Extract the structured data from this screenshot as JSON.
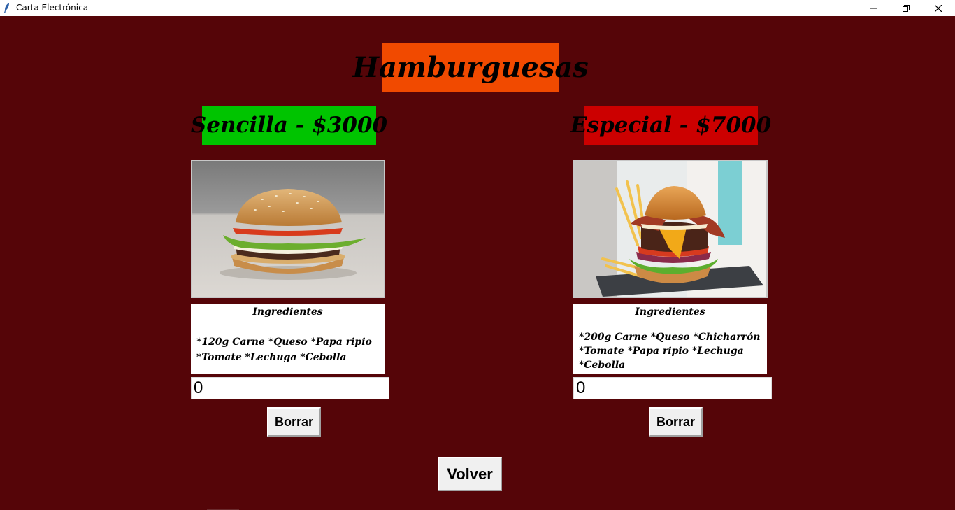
{
  "window": {
    "title": "Carta Electrónica",
    "icons": [
      "feather-icon",
      "minimize-icon",
      "maximize-icon",
      "close-icon"
    ]
  },
  "menu": {
    "title": "Hamburguesas",
    "items": [
      {
        "name": "Sencilla - $3000",
        "title_color": "#00c400",
        "image": "burger-simple-photo",
        "ingredients_label": "Ingredientes",
        "ingredients_text": "*120g Carne *Queso *Papa ripio\n*Tomate *Lechuga *Cebolla",
        "quantity": "0",
        "clear_label": "Borrar"
      },
      {
        "name": "Especial - $7000",
        "title_color": "#cc0000",
        "image": "burger-special-photo",
        "ingredients_label": "Ingredientes",
        "ingredients_text": "*200g Carne *Queso *Chicharrón\n*Tomate *Papa ripio *Lechuga\n*Cebolla",
        "quantity": "0",
        "clear_label": "Borrar"
      }
    ],
    "back_label": "Volver"
  },
  "colors": {
    "background": "#550508",
    "title_bg": "#f14a00"
  }
}
